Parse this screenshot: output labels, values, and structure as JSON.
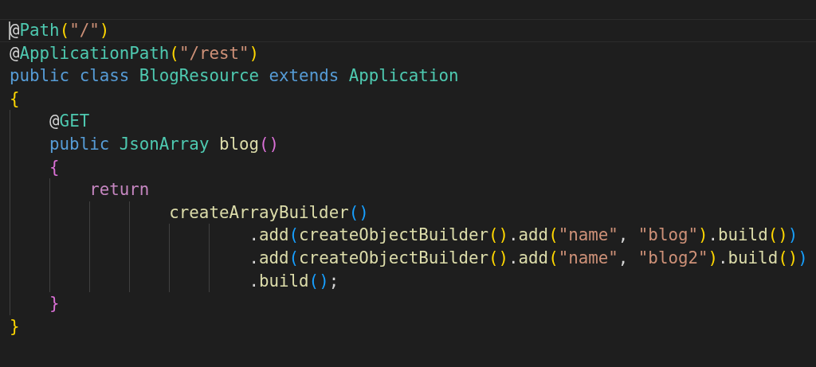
{
  "editor": {
    "lines": [
      {
        "current": true,
        "tokens": [
          {
            "text": "@",
            "kind": "plain"
          },
          {
            "text": "Path",
            "kind": "annotation"
          },
          {
            "text": "(",
            "kind": "bracket1"
          },
          {
            "text": "\"/\"",
            "kind": "string"
          },
          {
            "text": ")",
            "kind": "bracket1"
          }
        ]
      },
      {
        "current": false,
        "tokens": [
          {
            "text": "@",
            "kind": "plain"
          },
          {
            "text": "ApplicationPath",
            "kind": "annotation"
          },
          {
            "text": "(",
            "kind": "bracket1"
          },
          {
            "text": "\"/rest\"",
            "kind": "string"
          },
          {
            "text": ")",
            "kind": "bracket1"
          }
        ]
      },
      {
        "current": false,
        "tokens": [
          {
            "text": "public class",
            "kind": "keyword"
          },
          {
            "text": " BlogResource",
            "kind": "type"
          },
          {
            "text": " extends",
            "kind": "keyword"
          },
          {
            "text": " Application",
            "kind": "type"
          }
        ]
      },
      {
        "current": false,
        "tokens": [
          {
            "text": "{",
            "kind": "bracket1"
          }
        ],
        "children": [
          {
            "current": false,
            "tokens": [
              {
                "text": "@",
                "kind": "plain"
              },
              {
                "text": "GET",
                "kind": "annotation"
              }
            ]
          },
          {
            "current": false,
            "tokens": [
              {
                "text": "public",
                "kind": "keyword"
              },
              {
                "text": " JsonArray",
                "kind": "type"
              },
              {
                "text": " blog",
                "kind": "method"
              },
              {
                "text": "()",
                "kind": "bracket2"
              }
            ]
          },
          {
            "current": false,
            "tokens": [
              {
                "text": "{",
                "kind": "bracket2"
              }
            ],
            "children": [
              {
                "current": false,
                "tokens": [
                  {
                    "text": "return",
                    "kind": "control"
                  }
                ],
                "children": [
                  {
                    "current": false,
                    "continuation": true,
                    "tokens": [
                      {
                        "text": "createArrayBuilder",
                        "kind": "method"
                      },
                      {
                        "text": "()",
                        "kind": "bracket3"
                      }
                    ],
                    "children": [
                      {
                        "current": false,
                        "continuation": true,
                        "tokens": [
                          {
                            "text": ".",
                            "kind": "plain"
                          },
                          {
                            "text": "add",
                            "kind": "method"
                          },
                          {
                            "text": "(",
                            "kind": "bracket3"
                          },
                          {
                            "text": "createObjectBuilder",
                            "kind": "method"
                          },
                          {
                            "text": "()",
                            "kind": "bracket1"
                          },
                          {
                            "text": ".",
                            "kind": "plain"
                          },
                          {
                            "text": "add",
                            "kind": "method"
                          },
                          {
                            "text": "(",
                            "kind": "bracket1"
                          },
                          {
                            "text": "\"name\"",
                            "kind": "string"
                          },
                          {
                            "text": ",",
                            "kind": "plain"
                          },
                          {
                            "text": " \"blog\"",
                            "kind": "string"
                          },
                          {
                            "text": ")",
                            "kind": "bracket1"
                          },
                          {
                            "text": ".",
                            "kind": "plain"
                          },
                          {
                            "text": "build",
                            "kind": "method"
                          },
                          {
                            "text": "()",
                            "kind": "bracket1"
                          },
                          {
                            "text": ")",
                            "kind": "bracket3"
                          }
                        ]
                      },
                      {
                        "current": false,
                        "continuation": true,
                        "tokens": [
                          {
                            "text": ".",
                            "kind": "plain"
                          },
                          {
                            "text": "add",
                            "kind": "method"
                          },
                          {
                            "text": "(",
                            "kind": "bracket3"
                          },
                          {
                            "text": "createObjectBuilder",
                            "kind": "method"
                          },
                          {
                            "text": "()",
                            "kind": "bracket1"
                          },
                          {
                            "text": ".",
                            "kind": "plain"
                          },
                          {
                            "text": "add",
                            "kind": "method"
                          },
                          {
                            "text": "(",
                            "kind": "bracket1"
                          },
                          {
                            "text": "\"name\"",
                            "kind": "string"
                          },
                          {
                            "text": ",",
                            "kind": "plain"
                          },
                          {
                            "text": " \"blog2\"",
                            "kind": "string"
                          },
                          {
                            "text": ")",
                            "kind": "bracket1"
                          },
                          {
                            "text": ".",
                            "kind": "plain"
                          },
                          {
                            "text": "build",
                            "kind": "method"
                          },
                          {
                            "text": "()",
                            "kind": "bracket1"
                          },
                          {
                            "text": ")",
                            "kind": "bracket3"
                          }
                        ]
                      },
                      {
                        "current": false,
                        "continuation": true,
                        "tokens": [
                          {
                            "text": ".",
                            "kind": "plain"
                          },
                          {
                            "text": "build",
                            "kind": "method"
                          },
                          {
                            "text": "()",
                            "kind": "bracket3"
                          },
                          {
                            "text": ";",
                            "kind": "plain"
                          }
                        ]
                      }
                    ]
                  }
                ]
              }
            ]
          },
          {
            "current": false,
            "tokens": [
              {
                "text": "}",
                "kind": "bracket2"
              }
            ]
          }
        ]
      },
      {
        "current": false,
        "tokens": [
          {
            "text": "}",
            "kind": "bracket1"
          }
        ]
      }
    ]
  }
}
